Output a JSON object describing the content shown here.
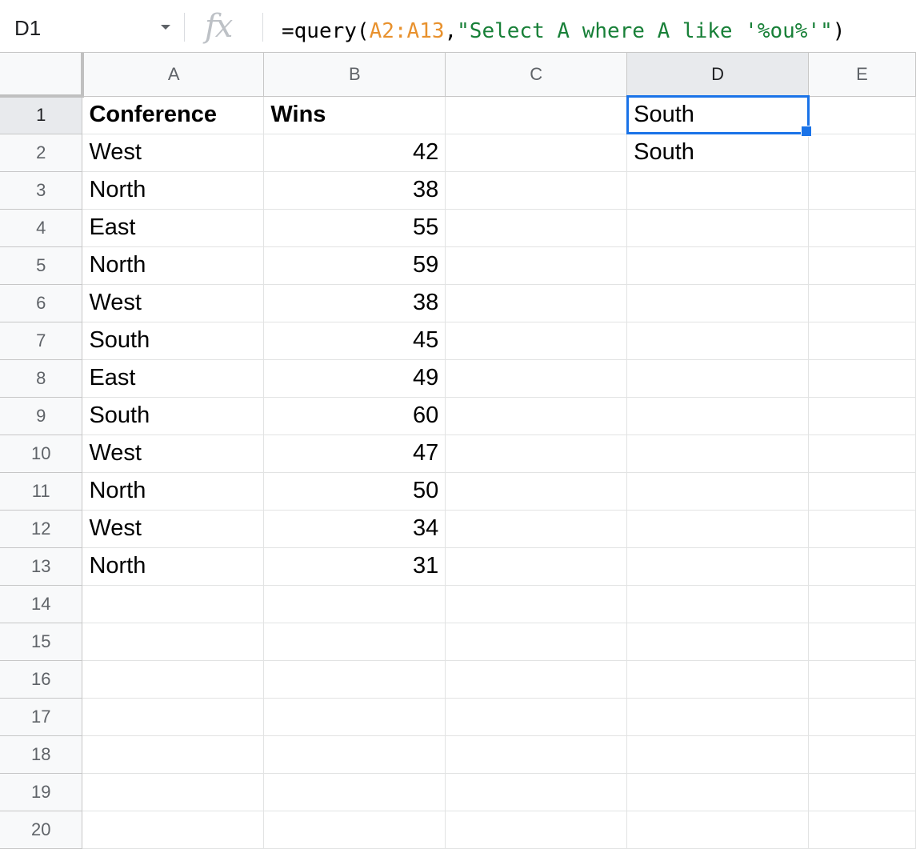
{
  "formula_bar": {
    "name_box": "D1",
    "fx_label": "fx",
    "formula_prefix": "=query(",
    "formula_range": "A2:A13",
    "formula_comma": ",",
    "formula_string": "\"Select A where A like '%ou%'\"",
    "formula_suffix": ")"
  },
  "columns": [
    "A",
    "B",
    "C",
    "D",
    "E"
  ],
  "row_numbers": [
    "1",
    "2",
    "3",
    "4",
    "5",
    "6",
    "7",
    "8",
    "9",
    "10",
    "11",
    "12",
    "13",
    "14",
    "15",
    "16",
    "17",
    "18",
    "19",
    "20"
  ],
  "rows": [
    {
      "a": "Conference",
      "b": "Wins",
      "d": "South"
    },
    {
      "a": "West",
      "b": "42",
      "d": "South"
    },
    {
      "a": "North",
      "b": "38",
      "d": ""
    },
    {
      "a": "East",
      "b": "55",
      "d": ""
    },
    {
      "a": "North",
      "b": "59",
      "d": ""
    },
    {
      "a": "West",
      "b": "38",
      "d": ""
    },
    {
      "a": "South",
      "b": "45",
      "d": ""
    },
    {
      "a": "East",
      "b": "49",
      "d": ""
    },
    {
      "a": "South",
      "b": "60",
      "d": ""
    },
    {
      "a": "West",
      "b": "47",
      "d": ""
    },
    {
      "a": "North",
      "b": "50",
      "d": ""
    },
    {
      "a": "West",
      "b": "34",
      "d": ""
    },
    {
      "a": "North",
      "b": "31",
      "d": ""
    },
    {
      "a": "",
      "b": "",
      "d": ""
    },
    {
      "a": "",
      "b": "",
      "d": ""
    },
    {
      "a": "",
      "b": "",
      "d": ""
    },
    {
      "a": "",
      "b": "",
      "d": ""
    },
    {
      "a": "",
      "b": "",
      "d": ""
    },
    {
      "a": "",
      "b": "",
      "d": ""
    },
    {
      "a": "",
      "b": "",
      "d": ""
    }
  ],
  "colors": {
    "selection": "#1a73e8",
    "range_ref": "#e8912d",
    "string_literal": "#188038"
  }
}
